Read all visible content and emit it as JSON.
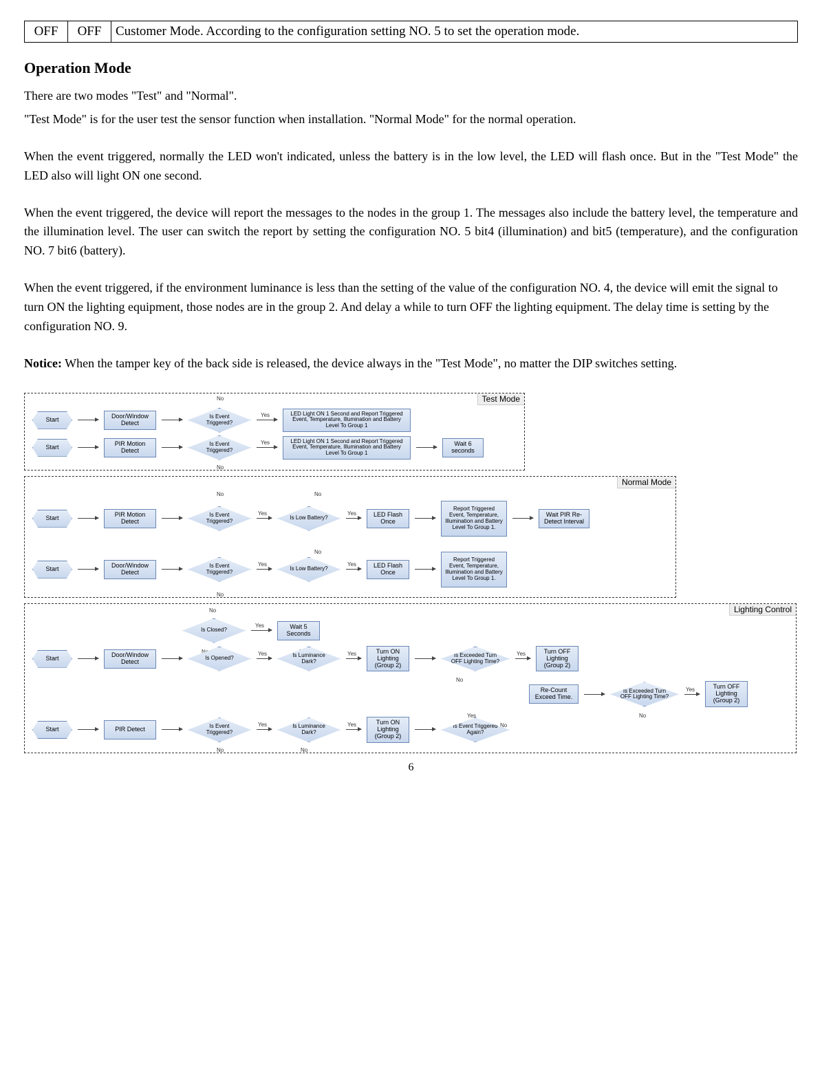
{
  "table": {
    "col1": "OFF",
    "col2": "OFF",
    "desc": "Customer Mode. According to the configuration setting NO. 5 to set the operation mode."
  },
  "heading": "Operation Mode",
  "para1a": "There are two modes \"Test\" and \"Normal\".",
  "para1b": "\"Test Mode\" is for the user test the sensor function when installation. \"Normal Mode\" for the normal operation.",
  "para2": "When the event triggered, normally the LED won't indicated, unless the battery is in the low level, the LED will flash once. But in the \"Test Mode\" the LED also will light ON one second.",
  "para3": "When the event triggered, the device will report the messages to the nodes in the group 1. The messages also include the battery level, the temperature and the illumination level. The user can switch the report by setting the configuration NO. 5 bit4 (illumination) and bit5 (temperature), and the configuration NO. 7 bit6 (battery).",
  "para4": "When the event triggered, if the environment luminance is less than the setting of the value of the configuration NO. 4, the device will emit the signal to turn ON the lighting equipment, those nodes are in the group 2. And delay a while to turn OFF the lighting equipment. The delay time is setting by the configuration NO. 9.",
  "notice_label": "Notice:",
  "notice_text": " When the tamper key of the back side is released, the device always in the \"Test Mode\", no matter the DIP switches setting.",
  "flow": {
    "test_label": "Test Mode",
    "normal_label": "Normal Mode",
    "lighting_label": "Lighting Control",
    "start": "Start",
    "door_detect": "Door/Window Detect",
    "pir_detect": "PIR Motion Detect",
    "pir_detect2": "PIR Detect",
    "event_triggered": "Is Event Triggered?",
    "event_triggered_again": "Is Event Triggered Again?",
    "led_on_report": "LED Light ON 1 Second and Report Triggered Event, Temperature, Illumination and Battery Level To Group 1",
    "wait6": "Wait 6 seconds",
    "low_battery": "Is Low Battery?",
    "led_flash": "LED Flash Once",
    "report_group1": "Report Triggered Event, Temperature, Illumination and Battery Level To Group 1.",
    "wait_pir": "Wait PIR Re-Detect Interval",
    "is_closed": "Is Closed?",
    "is_opened": "Is Opened?",
    "wait5": "Wait 5 Seconds",
    "is_lum_dark": "Is Luminance Dark?",
    "turn_on_g2": "Turn ON Lighting (Group 2)",
    "exceed_time": "Is Exceeded Turn OFF Lighting Time?",
    "turn_off_g2": "Turn OFF Lighting (Group 2)",
    "recount": "Re-Count Exceed Time.",
    "yes": "Yes",
    "no": "No"
  },
  "pagenum": "6",
  "chart_data": [
    {
      "type": "flowchart",
      "title": "Test Mode",
      "lanes": [
        {
          "nodes": [
            "Start",
            "Door/Window Detect",
            "Is Event Triggered?",
            "LED Light ON 1 Second and Report Triggered Event, Temperature, Illumination and Battery Level To Group 1"
          ],
          "edges": [
            {
              "from": 0,
              "to": 1
            },
            {
              "from": 1,
              "to": 2
            },
            {
              "from": 2,
              "to": 3,
              "label": "Yes"
            },
            {
              "from": 2,
              "to": 1,
              "label": "No",
              "back": true
            },
            {
              "from": 3,
              "to": 1,
              "back": true
            }
          ]
        },
        {
          "nodes": [
            "Start",
            "PIR Motion Detect",
            "Is Event Triggered?",
            "LED Light ON 1 Second and Report Triggered Event, Temperature, Illumination and Battery Level To Group 1",
            "Wait 6 seconds"
          ],
          "edges": [
            {
              "from": 0,
              "to": 1
            },
            {
              "from": 1,
              "to": 2
            },
            {
              "from": 2,
              "to": 3,
              "label": "Yes"
            },
            {
              "from": 2,
              "to": 1,
              "label": "No",
              "back": true
            },
            {
              "from": 3,
              "to": 4
            },
            {
              "from": 4,
              "to": 1,
              "back": true
            }
          ]
        }
      ]
    },
    {
      "type": "flowchart",
      "title": "Normal Mode",
      "lanes": [
        {
          "nodes": [
            "Start",
            "PIR Motion Detect",
            "Is Event Triggered?",
            "Is Low Battery?",
            "LED Flash Once",
            "Report Triggered Event, Temperature, Illumination and Battery Level To Group 1.",
            "Wait PIR Re-Detect Interval"
          ],
          "edges": [
            {
              "from": 0,
              "to": 1
            },
            {
              "from": 1,
              "to": 2
            },
            {
              "from": 2,
              "to": 3,
              "label": "Yes"
            },
            {
              "from": 2,
              "to": 1,
              "label": "No",
              "back": true
            },
            {
              "from": 3,
              "to": 4,
              "label": "Yes"
            },
            {
              "from": 3,
              "to": 5,
              "label": "No"
            },
            {
              "from": 4,
              "to": 5
            },
            {
              "from": 5,
              "to": 6
            },
            {
              "from": 6,
              "to": 1,
              "back": true
            }
          ]
        },
        {
          "nodes": [
            "Start",
            "Door/Window Detect",
            "Is Event Triggered?",
            "Is Low Battery?",
            "LED Flash Once",
            "Report Triggered Event, Temperature, Illumination and Battery Level To Group 1."
          ],
          "edges": [
            {
              "from": 0,
              "to": 1
            },
            {
              "from": 1,
              "to": 2
            },
            {
              "from": 2,
              "to": 3,
              "label": "Yes"
            },
            {
              "from": 2,
              "to": 1,
              "label": "No",
              "back": true
            },
            {
              "from": 3,
              "to": 4,
              "label": "Yes"
            },
            {
              "from": 3,
              "to": 5,
              "label": "No"
            },
            {
              "from": 4,
              "to": 5
            },
            {
              "from": 5,
              "to": 1,
              "back": true
            }
          ]
        }
      ]
    },
    {
      "type": "flowchart",
      "title": "Lighting Control",
      "lanes": [
        {
          "nodes": [
            "Start",
            "Door/Window Detect",
            "Is Closed?",
            "Wait 5 Seconds",
            "Is Opened?",
            "Is Luminance Dark?",
            "Turn ON Lighting (Group 2)",
            "Is Exceeded Turn OFF Lighting Time?",
            "Turn OFF Lighting (Group 2)",
            "Re-Count Exceed Time.",
            "Is Exceeded Turn OFF Lighting Time?",
            "Turn OFF Lighting (Group 2)"
          ],
          "edges": [
            {
              "from": 0,
              "to": 1
            },
            {
              "from": 1,
              "to": 4
            },
            {
              "from": 4,
              "to": 5,
              "label": "Yes"
            },
            {
              "from": 4,
              "to": 2,
              "label": "No"
            },
            {
              "from": 2,
              "to": 3,
              "label": "Yes"
            },
            {
              "from": 2,
              "to": 1,
              "label": "No",
              "back": true
            },
            {
              "from": 3,
              "to": 4,
              "back": true
            },
            {
              "from": 5,
              "to": 6,
              "label": "Yes"
            },
            {
              "from": 5,
              "to": 4,
              "label": "No",
              "back": true
            },
            {
              "from": 6,
              "to": 7
            },
            {
              "from": 7,
              "to": 8,
              "label": "Yes"
            },
            {
              "from": 7,
              "to": 9,
              "label": "No"
            },
            {
              "from": 9,
              "to": 10
            },
            {
              "from": 10,
              "to": 11,
              "label": "Yes"
            },
            {
              "from": 10,
              "to": 9,
              "label": "No",
              "back": true
            },
            {
              "from": 8,
              "to": 1,
              "back": true
            }
          ]
        },
        {
          "nodes": [
            "Start",
            "PIR Detect",
            "Is Event Triggered?",
            "Is Luminance Dark?",
            "Turn ON Lighting (Group 2)",
            "Is Event Triggered Again?"
          ],
          "edges": [
            {
              "from": 0,
              "to": 1
            },
            {
              "from": 1,
              "to": 2
            },
            {
              "from": 2,
              "to": 3,
              "label": "Yes"
            },
            {
              "from": 2,
              "to": 1,
              "label": "No",
              "back": true
            },
            {
              "from": 3,
              "to": 4,
              "label": "Yes"
            },
            {
              "from": 3,
              "to": 1,
              "label": "No",
              "back": true
            },
            {
              "from": 4,
              "to": 5
            },
            {
              "from": 5,
              "to": "Re-Count Exceed Time.",
              "label": "Yes"
            },
            {
              "from": 5,
              "to": "Is Exceeded Turn OFF Lighting Time?",
              "label": "No"
            }
          ]
        }
      ]
    }
  ]
}
